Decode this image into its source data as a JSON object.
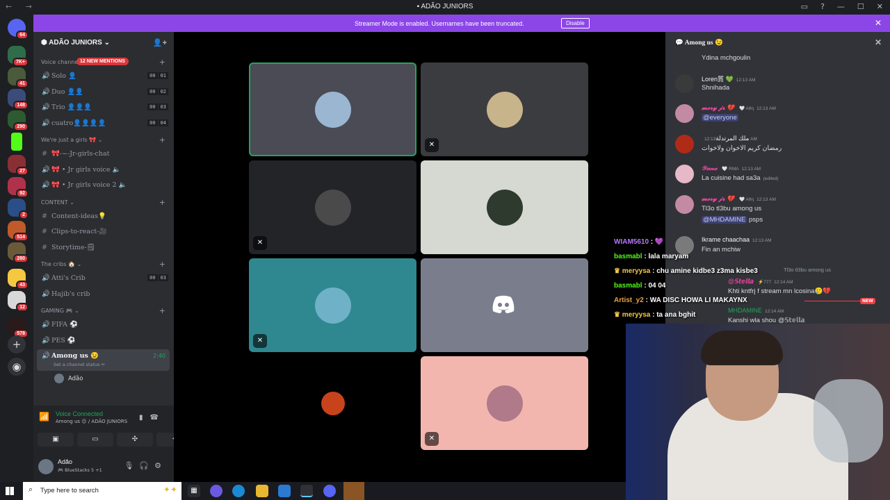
{
  "window": {
    "title": "ADÃO JUNIORS"
  },
  "banner": {
    "text": "Streamer Mode is enabled. Usernames have been truncated.",
    "button": "Disable"
  },
  "rail": {
    "badges": [
      "64",
      "7K+",
      "41",
      "148",
      "290",
      "",
      "27",
      "92",
      "2",
      "514",
      "280",
      "43",
      "12",
      "578"
    ]
  },
  "server": {
    "name": "ADÃO JUNIORS"
  },
  "mentions": "12 NEW MENTIONS",
  "categories": {
    "voice": "Voice channels",
    "girls": "We're just a girls 🎀",
    "content": "CONTENT",
    "cribs": "The cribs 🏠",
    "gaming": "GAMING 🎮"
  },
  "channels": {
    "solo": {
      "name": "Solo 👤",
      "lim": [
        "00",
        "01"
      ]
    },
    "duo": {
      "name": "Duo 👤👤",
      "lim": [
        "00",
        "02"
      ]
    },
    "trio": {
      "name": "Trio 👤👤👤",
      "lim": [
        "00",
        "03"
      ]
    },
    "cuatro": {
      "name": "cuatro👤👤👤👤",
      "lim": [
        "00",
        "04"
      ]
    },
    "girls_chat": "🎀-~-Jr-girls-chat",
    "girls_voice": "🎀 • Jr girls voice 🔈",
    "girls_voice2": "🎀 • Jr girls voice 2 🔈",
    "content_ideas": "Content-ideas💡",
    "clips": "Clips-to-react-🎥",
    "storytime": "Storytime-🗒",
    "attis": {
      "name": "Atti's Crib",
      "lim": [
        "00",
        "03"
      ]
    },
    "hajibs": "Hajib's crib",
    "fifa": "FIFA ⚽",
    "pes": "PES ⚽",
    "among": {
      "name": "Among us 😉",
      "time": "2:40",
      "status": "Set a channel status ✏"
    },
    "member": "Adão"
  },
  "voice": {
    "status": "Voice Connected",
    "detail": "Among us 😉 / ADÃO JUNIORS"
  },
  "user": {
    "name": "Adão",
    "activity": "🎮 BlueStacks 5 +1"
  },
  "chat": {
    "channel": "Among us 😉",
    "messages": [
      {
        "body": "Ydina mchgoulin"
      },
      {
        "name": "Loren質 💚",
        "ts": "12:13 AM",
        "body": "Shnihada"
      },
      {
        "name": "𝓶𝓮𝓻𝔂 𝓳𝓻 💔",
        "tag": "🤍 Aθη",
        "ts": "12:13 AM",
        "body": "@everyone"
      },
      {
        "name": "ملك المرتدلة",
        "ts": "12:13 AM",
        "body": "رمضان كريم الاخوان ولاخوات"
      },
      {
        "name": "𝒴𝓊𝓃𝒶",
        "tag": "🤍 RMA",
        "ts": "12:13 AM",
        "body": "La cuisine had sa3a",
        "edited": "(edited)"
      },
      {
        "name": "𝓶𝓮𝓻𝔂 𝓳𝓻 💔",
        "tag": "🤍 Aθη",
        "ts": "12:13 AM",
        "body": "Tl3o tl3bu among us",
        "mention": "@MHDAMINE",
        "after": " psps"
      },
      {
        "name": "Ikrame chaachaa",
        "ts": "12:13 AM",
        "body": "Fin an mchiw"
      },
      {
        "reply": "Tl3o tl3bu among us"
      },
      {
        "name": "@𝕊𝕥𝕖𝕝𝕝𝕒",
        "tag": "⚡777",
        "ts": "12:14 AM",
        "body": "Khti kntfrj f stream mn lcosina🥲💔"
      },
      {
        "new": "NEW"
      },
      {
        "name": "MHDAMINE",
        "ts": "12:14 AM",
        "body": "Kanshi wla shou @𝕊𝕥𝕖𝕝𝕝𝕒"
      }
    ]
  },
  "overlay": [
    {
      "user": "WIAM5610",
      "text": " : 💜"
    },
    {
      "user": "basmabl",
      "text": " : lala maryam"
    },
    {
      "user": "meryysa",
      "text": " : chu amine kidbe3 z3ma kisbe3"
    },
    {
      "user": "basmabl",
      "text": " : 04 04"
    },
    {
      "user": "Artist_y2",
      "text": " : WA DISC HOWA LI MAKAYNX"
    },
    {
      "user": "meryysa",
      "text": " : ta ana bghit"
    }
  ],
  "taskbar": {
    "search": "Type here to search"
  },
  "colors": {
    "accent": "#5865f2",
    "banner": "#8c46e8",
    "online": "#23a55a",
    "mention": "#da373c"
  }
}
